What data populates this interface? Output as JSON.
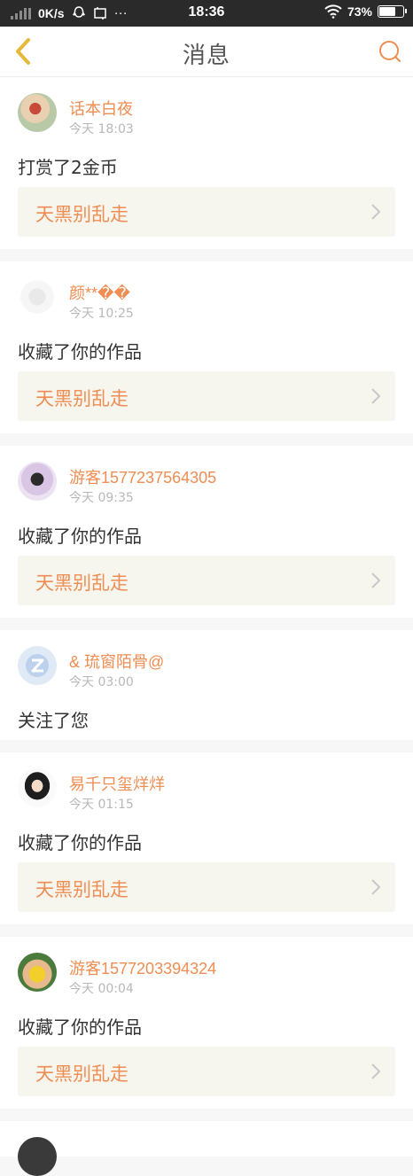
{
  "status_bar": {
    "speed": "0K/s",
    "time": "18:36",
    "battery": "73%",
    "battery_level": 0.73
  },
  "header": {
    "title": "消息"
  },
  "messages": [
    {
      "name": "话本白夜",
      "time": "今天 18:03",
      "action": "打赏了2金币",
      "work": "天黑别乱走"
    },
    {
      "name": "颜**��",
      "time": "今天 10:25",
      "action": "收藏了你的作品",
      "work": "天黑别乱走"
    },
    {
      "name": "游客1577237564305",
      "time": "今天 09:35",
      "action": "收藏了你的作品",
      "work": "天黑别乱走"
    },
    {
      "name": "& 琉窗陌骨@",
      "time": "今天 03:00",
      "action": "关注了您"
    },
    {
      "name": "易千只玺烊烊",
      "time": "今天 01:15",
      "action": "收藏了你的作品",
      "work": "天黑别乱走"
    },
    {
      "name": "游客1577203394324",
      "time": "今天 00:04",
      "action": "收藏了你的作品",
      "work": "天黑别乱走"
    }
  ],
  "colors": {
    "accent": "#ef8d52",
    "back_arrow": "#e5b93a",
    "card_bg": "#ffffff",
    "work_bg": "#f6f6ef"
  }
}
